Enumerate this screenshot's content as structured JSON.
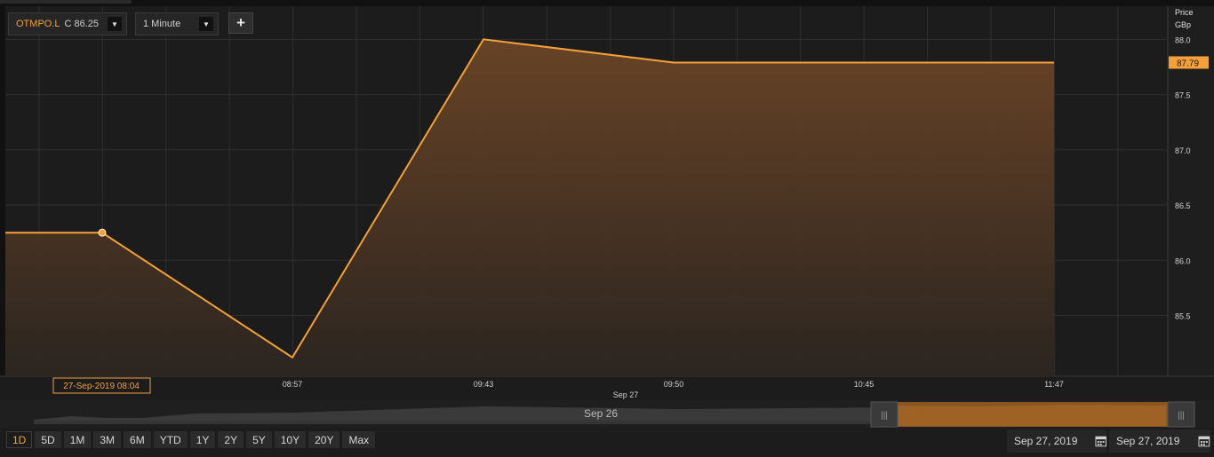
{
  "toolbar": {
    "symbol": "OTMPO.L",
    "close_text": "C 86.25",
    "interval": "1 Minute",
    "add_label": "+"
  },
  "axis": {
    "title": "Price",
    "unit": "GBp",
    "last_price_label": "87.79"
  },
  "hover_label": "27-Sep-2019 08:04",
  "date_caption": "Sep 27",
  "navigator": {
    "label": "Sep 26"
  },
  "ranges": [
    "1D",
    "5D",
    "1M",
    "3M",
    "6M",
    "YTD",
    "1Y",
    "2Y",
    "5Y",
    "10Y",
    "20Y",
    "Max"
  ],
  "active_range": "1D",
  "date_from": "Sep 27, 2019",
  "date_to": "Sep 27, 2019",
  "colors": {
    "accent": "#f6a03c",
    "background": "#1c1c1c",
    "grid": "#2f2f2f"
  },
  "chart_data": {
    "type": "area",
    "x": [
      "08:04",
      "08:57",
      "09:43",
      "09:50",
      "10:45",
      "11:47"
    ],
    "series": [
      {
        "values": [
          86.25,
          85.12,
          88.0,
          87.79,
          87.79,
          87.79
        ]
      }
    ],
    "pre_line_value": 86.25,
    "y_ticks": [
      85.5,
      86.0,
      86.5,
      87.0,
      87.5,
      88.0
    ],
    "x_tick_labels": [
      "08:57",
      "09:43",
      "09:50",
      "10:45",
      "11:47"
    ],
    "ylim": [
      84.95,
      88.3
    ],
    "last_value": 87.79,
    "highlight_point": {
      "x": "08:04",
      "y": 86.25
    },
    "grid": true
  }
}
